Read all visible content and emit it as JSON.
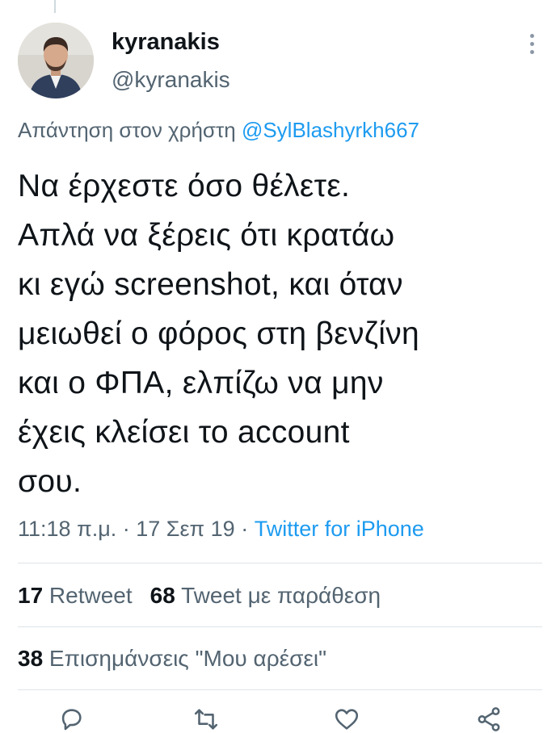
{
  "author": {
    "display_name": "kyranakis",
    "handle": "@kyranakis"
  },
  "reply": {
    "prefix": "Απάντηση στον χρήστη ",
    "mention": "@SylBlashyrkh667"
  },
  "tweet": {
    "lines": [
      "Να έρχεστε όσο θέλετε.",
      "Απλά να ξέρεις ότι κρατάω",
      "κι εγώ screenshot, και όταν",
      "μειωθεί ο φόρος στη βενζίνη",
      "και ο ΦΠΑ, ελπίζω να μην",
      "έχεις κλείσει το account",
      "σου."
    ]
  },
  "meta": {
    "time": "11:18 π.μ.",
    "separator": " · ",
    "date": "17 Σεπ 19",
    "source": "Twitter for iPhone"
  },
  "stats": {
    "retweets": "17",
    "retweets_label": " Retweet",
    "quotes": "68",
    "quotes_label": " Tweet με παράθεση",
    "likes": "38",
    "likes_label": " Επισημάνσεις \"Μου αρέσει\""
  },
  "actions": {
    "icons": [
      "reply-icon",
      "retweet-icon",
      "like-icon",
      "share-icon"
    ]
  },
  "colors": {
    "accent": "#1d9bf0",
    "text": "#0f1419",
    "secondary": "#536471",
    "divider": "#dfe4e8"
  }
}
